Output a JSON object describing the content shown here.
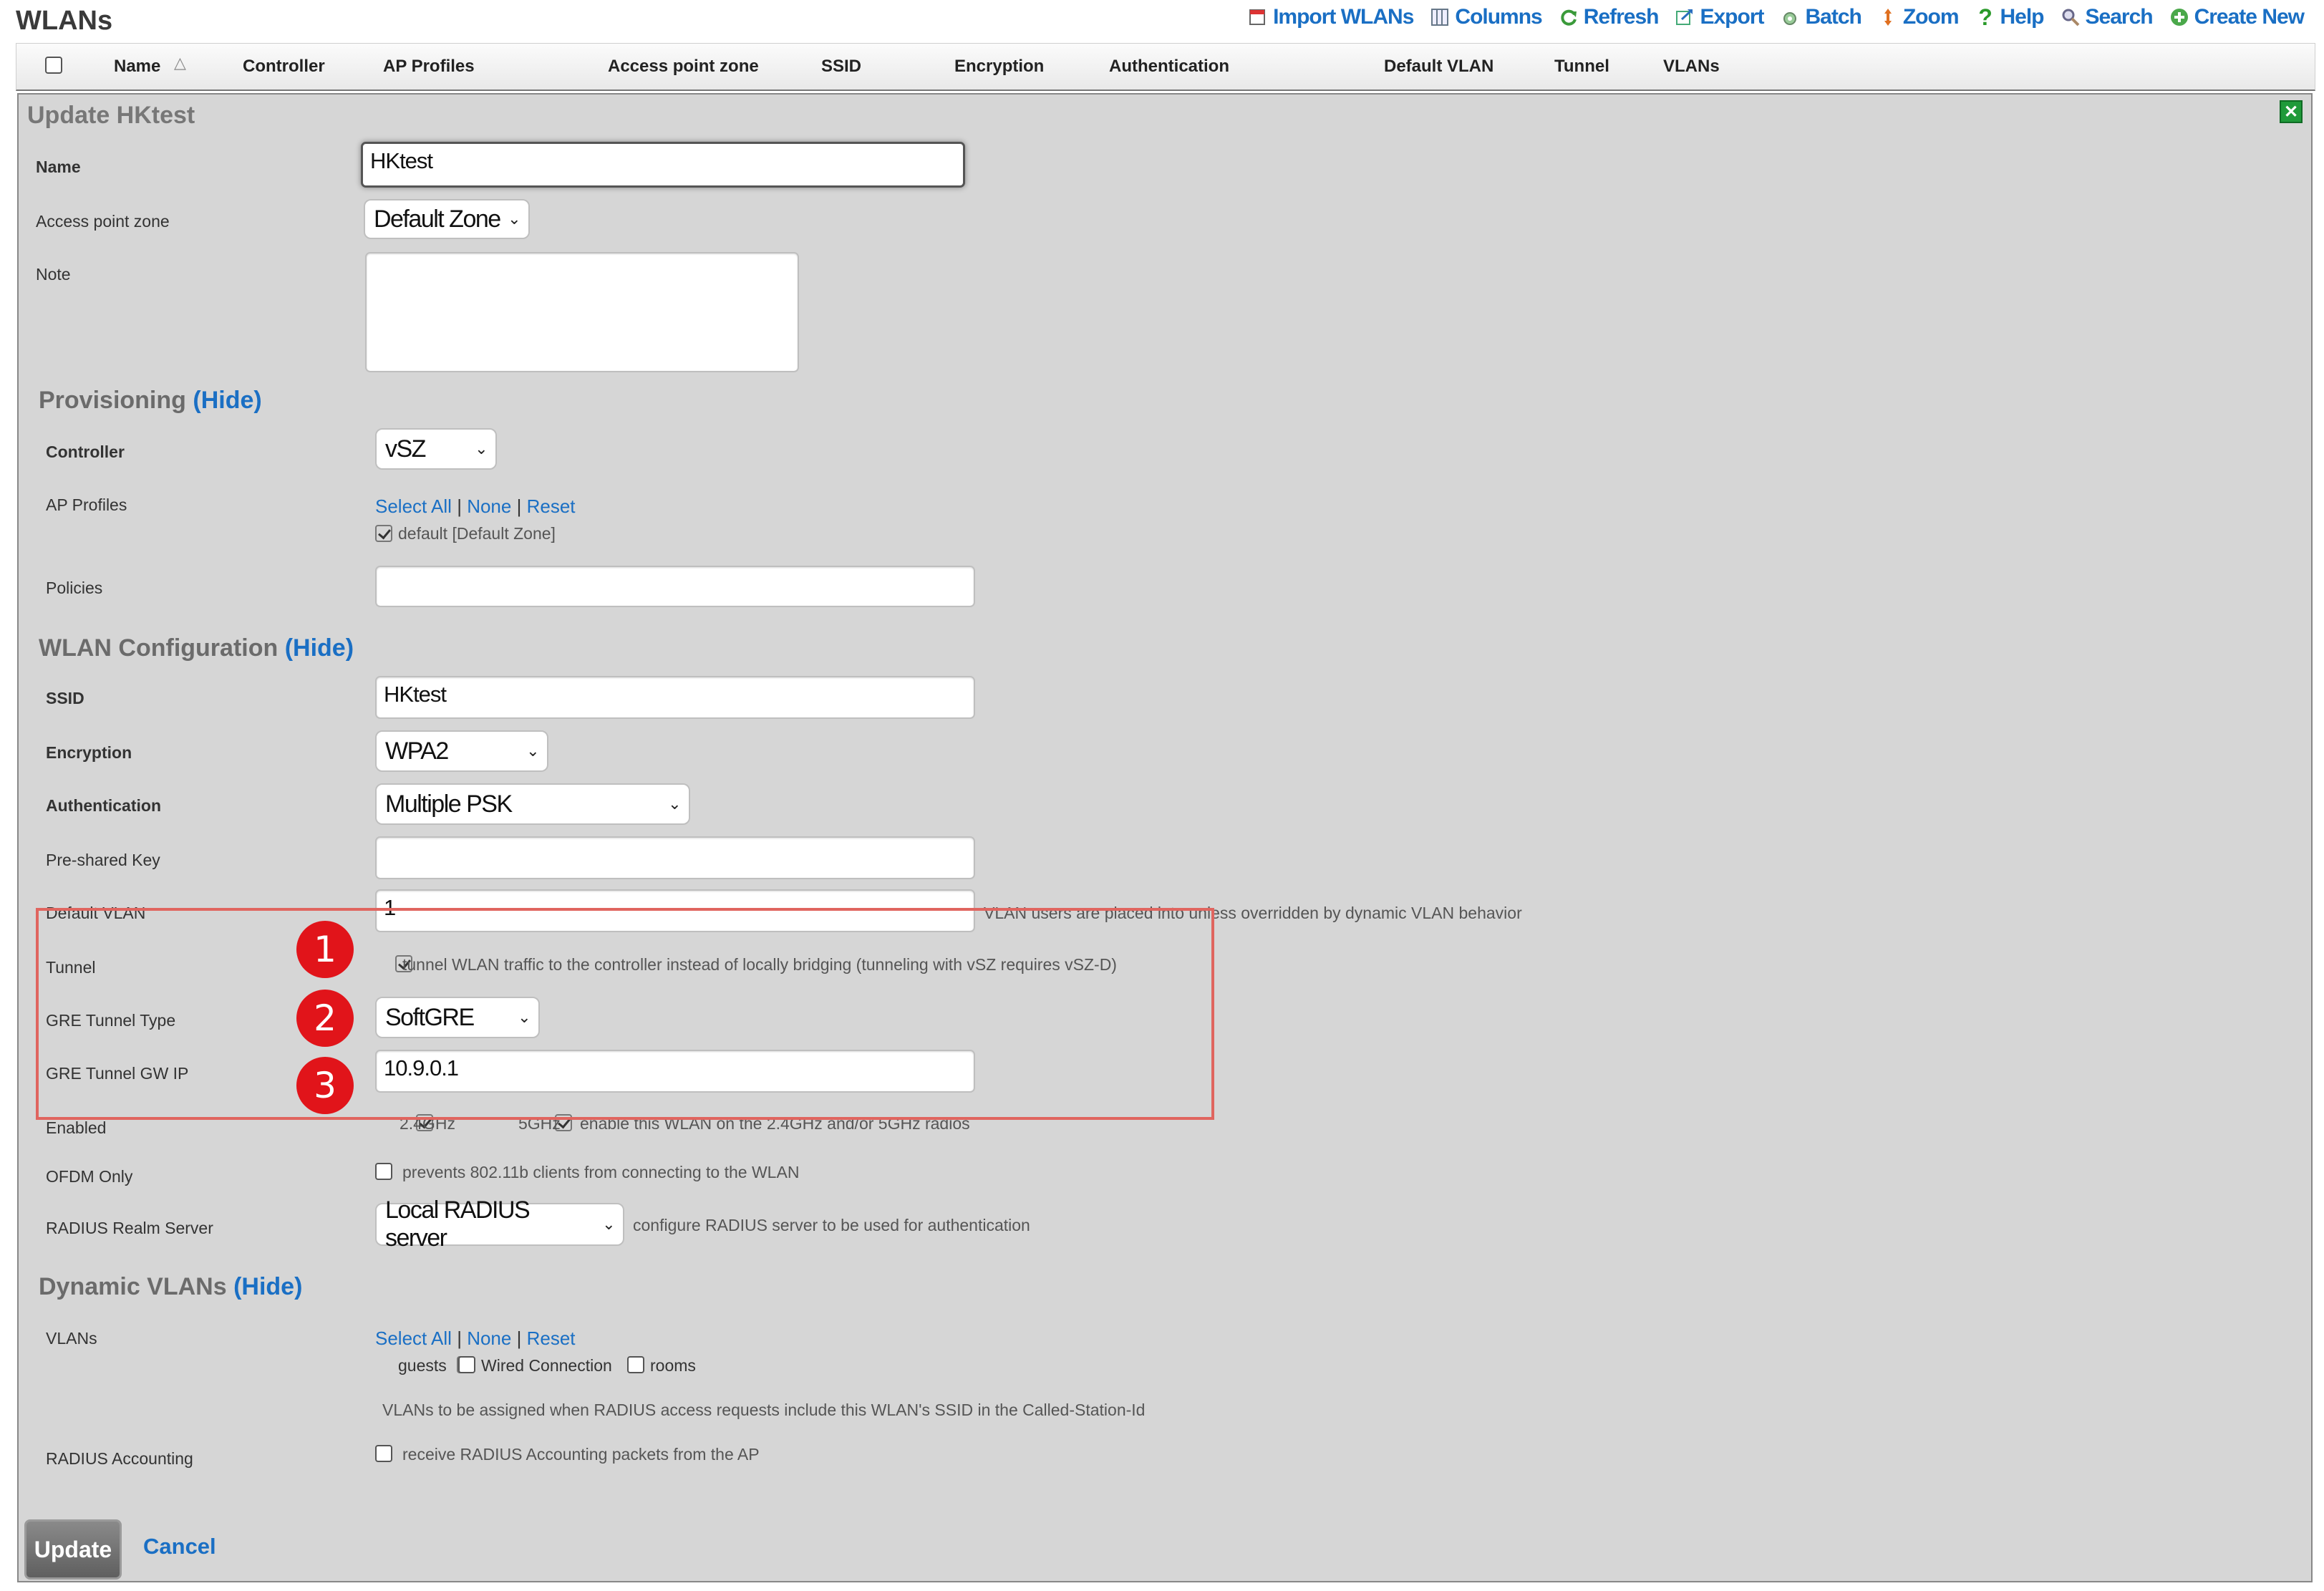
{
  "page": {
    "title": "WLANs"
  },
  "toolbar": [
    {
      "label": "Import WLANs",
      "icon": "import-icon"
    },
    {
      "label": "Columns",
      "icon": "columns-icon"
    },
    {
      "label": "Refresh",
      "icon": "refresh-icon"
    },
    {
      "label": "Export",
      "icon": "export-icon"
    },
    {
      "label": "Batch",
      "icon": "batch-icon"
    },
    {
      "label": "Zoom",
      "icon": "zoom-icon"
    },
    {
      "label": "Help",
      "icon": "help-icon"
    },
    {
      "label": "Search",
      "icon": "search-icon"
    },
    {
      "label": "Create New",
      "icon": "create-new-icon"
    }
  ],
  "columns": [
    "Name",
    "Controller",
    "AP Profiles",
    "Access point zone",
    "SSID",
    "Encryption",
    "Authentication",
    "Default VLAN",
    "Tunnel",
    "VLANs"
  ],
  "panel": {
    "title": "Update HKtest",
    "name_label": "Name",
    "name_value": "HKtest",
    "zone_label": "Access point zone",
    "zone_value": "Default Zone",
    "note_label": "Note",
    "note_value": ""
  },
  "provisioning": {
    "heading": "Provisioning",
    "hide": "(Hide)",
    "controller_label": "Controller",
    "controller_value": "vSZ",
    "ap_profiles_label": "AP Profiles",
    "select_all": "Select All",
    "none": "None",
    "reset": "Reset",
    "sep": "|",
    "profile_option": "default [Default Zone]",
    "policies_label": "Policies",
    "policies_value": ""
  },
  "wlan": {
    "heading": "WLAN Configuration",
    "hide": "(Hide)",
    "ssid_label": "SSID",
    "ssid_value": "HKtest",
    "encryption_label": "Encryption",
    "encryption_value": "WPA2",
    "auth_label": "Authentication",
    "auth_value": "Multiple PSK",
    "psk_label": "Pre-shared Key",
    "psk_value": "",
    "vlan_label": "Default VLAN",
    "vlan_value": "1",
    "vlan_help": "VLAN users are placed into unless overridden by dynamic VLAN behavior",
    "tunnel_label": "Tunnel",
    "tunnel_help": "tunnel WLAN traffic to the controller instead of locally bridging (tunneling with vSZ requires vSZ-D)",
    "gre_type_label": "GRE Tunnel Type",
    "gre_type_value": "SoftGRE",
    "gre_ip_label": "GRE Tunnel GW IP",
    "gre_ip_value": "10.9.0.1",
    "enabled_label": "Enabled",
    "band_24": "2.4GHz",
    "band_5": "5GHz",
    "enabled_help": "enable this WLAN on the 2.4GHz and/or 5GHz radios",
    "ofdm_label": "OFDM Only",
    "ofdm_help": "prevents 802.11b clients from connecting to the WLAN",
    "radius_label": "RADIUS Realm Server",
    "radius_value": "Local RADIUS server",
    "radius_help": "configure RADIUS server to be used for authentication"
  },
  "dynamic": {
    "heading": "Dynamic VLANs",
    "hide": "(Hide)",
    "vlans_label": "VLANs",
    "select_all": "Select All",
    "none": "None",
    "reset": "Reset",
    "sep": "|",
    "opt_guests": "guests",
    "opt_wired": "Wired Connection",
    "opt_rooms": "rooms",
    "vlans_help": "VLANs to be assigned when RADIUS access requests include this WLAN's SSID in the Called-Station-Id",
    "accounting_label": "RADIUS Accounting",
    "accounting_help": "receive RADIUS Accounting packets from the AP"
  },
  "badges": [
    "1",
    "2",
    "3"
  ],
  "actions": {
    "update": "Update",
    "cancel": "Cancel"
  },
  "colors": {
    "link": "#1a6fc4",
    "badge": "#e1141a",
    "highlight": "#e0655f",
    "panel": "#d6d6d6"
  }
}
